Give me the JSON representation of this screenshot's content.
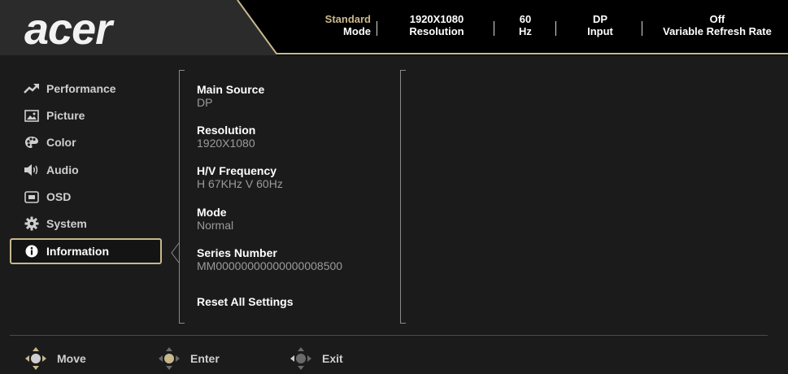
{
  "brand": "acer",
  "colors": {
    "gold": "#c7b88d",
    "bg": "#1b1b1b",
    "header_bg": "#000000"
  },
  "status_bar": [
    {
      "value": "Standard",
      "label": "Mode",
      "value_color": "#cbb98a"
    },
    {
      "value": "1920X1080",
      "label": "Resolution",
      "value_color": "#ffffff"
    },
    {
      "value": "60",
      "label": "Hz",
      "value_color": "#ffffff"
    },
    {
      "value": "DP",
      "label": "Input",
      "value_color": "#ffffff"
    },
    {
      "value": "Off",
      "label": "Variable Refresh Rate",
      "value_color": "#ffffff"
    }
  ],
  "sidebar": {
    "items": [
      {
        "label": "Performance",
        "icon": "trend-up-icon"
      },
      {
        "label": "Picture",
        "icon": "image-icon"
      },
      {
        "label": "Color",
        "icon": "palette-icon"
      },
      {
        "label": "Audio",
        "icon": "speaker-icon"
      },
      {
        "label": "OSD",
        "icon": "osd-window-icon"
      },
      {
        "label": "System",
        "icon": "gear-icon"
      },
      {
        "label": "Information",
        "icon": "info-icon",
        "active": true
      }
    ]
  },
  "information": {
    "main_source": {
      "label": "Main Source",
      "value": "DP"
    },
    "resolution": {
      "label": "Resolution",
      "value": "1920X1080"
    },
    "hv_frequency": {
      "label": "H/V Frequency",
      "value": "H 67KHz V 60Hz"
    },
    "mode": {
      "label": "Mode",
      "value": "Normal"
    },
    "series_number": {
      "label": "Series Number",
      "value": "MM00000000000000008500"
    },
    "reset_label": "Reset All Settings"
  },
  "footer": {
    "move": "Move",
    "enter": "Enter",
    "exit": "Exit"
  }
}
